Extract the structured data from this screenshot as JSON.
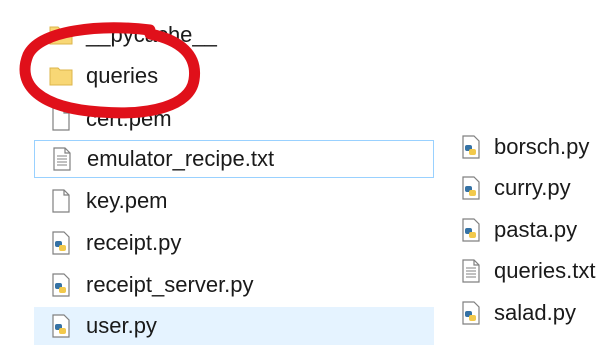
{
  "main_list": {
    "items": [
      {
        "name": "__pycache__",
        "type": "folder"
      },
      {
        "name": "queries",
        "type": "folder"
      },
      {
        "name": "cert.pem",
        "type": "file"
      },
      {
        "name": "emulator_recipe.txt",
        "type": "text"
      },
      {
        "name": "key.pem",
        "type": "file"
      },
      {
        "name": "receipt.py",
        "type": "python"
      },
      {
        "name": "receipt_server.py",
        "type": "python"
      },
      {
        "name": "user.py",
        "type": "python"
      }
    ]
  },
  "recipes_list": {
    "items": [
      {
        "name": "borsch.py",
        "type": "python"
      },
      {
        "name": "curry.py",
        "type": "python"
      },
      {
        "name": "pasta.py",
        "type": "python"
      },
      {
        "name": "queries.txt",
        "type": "text"
      },
      {
        "name": "salad.py",
        "type": "python"
      }
    ]
  },
  "colors": {
    "annotation_circle": "#e0101a",
    "selection_border": "#99d1ff",
    "hover_background": "#e5f3ff",
    "folder_yellow": "#f8d775"
  }
}
